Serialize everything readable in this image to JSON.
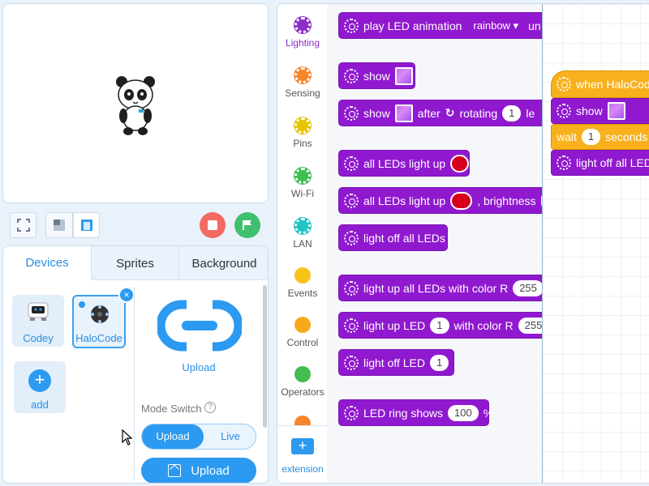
{
  "stage": {},
  "devices_panel": {
    "tabs": [
      {
        "label": "Devices",
        "active": true
      },
      {
        "label": "Sprites",
        "active": false
      },
      {
        "label": "Background",
        "active": false
      }
    ],
    "devices": [
      {
        "label": "Codey",
        "selected": false
      },
      {
        "label": "HaloCode",
        "selected": true
      }
    ],
    "close_glyph": "×",
    "add_label": "add",
    "add_glyph": "+",
    "upload_caption": "Upload",
    "mode_switch_label": "Mode Switch",
    "help_glyph": "?",
    "mode_options": [
      "Upload",
      "Live"
    ],
    "mode_selected": "Upload",
    "upload_button_label": "Upload"
  },
  "categories": {
    "items": [
      {
        "label": "Lighting",
        "color": "#8a2fc7",
        "active": true
      },
      {
        "label": "Sensing",
        "color": "#f5862a",
        "active": false
      },
      {
        "label": "Pins",
        "color": "#e6c400",
        "active": false
      },
      {
        "label": "Wi-Fi",
        "color": "#3fbf50",
        "active": false
      },
      {
        "label": "LAN",
        "color": "#1fc4c4",
        "active": false
      },
      {
        "label": "Events",
        "color": "#f8c31a",
        "active": false
      },
      {
        "label": "Control",
        "color": "#f8a91a",
        "active": false
      },
      {
        "label": "Operators",
        "color": "#43bd4f",
        "active": false
      }
    ],
    "extension_glyph": "+",
    "extension_label": "extension"
  },
  "palette": {
    "b1": {
      "text": "play LED animation",
      "option": "rainbow",
      "tail": "un"
    },
    "b2": {
      "text": "show"
    },
    "b3": {
      "text": "show",
      "after": "after",
      "rotating": "rotating",
      "value": "1",
      "tail": "le"
    },
    "b4": {
      "text": "all LEDs light up"
    },
    "b5": {
      "text": "all LEDs light up",
      "tail": ", brightness"
    },
    "b6": {
      "text": "light off all LEDs"
    },
    "b7": {
      "text": "light up all LEDs with color R",
      "value": "255"
    },
    "b8": {
      "text": "light up LED",
      "value": "1",
      "tail": "with color R",
      "value2": "255"
    },
    "b9": {
      "text": "light off LED",
      "value": "1"
    },
    "b10": {
      "text": "LED ring shows",
      "value": "100",
      "tail": "%"
    }
  },
  "workspace": {
    "hat": "when HaloCode",
    "show": "show",
    "wait_label": "wait",
    "wait_value": "1",
    "wait_unit": "seconds",
    "off": "light off all LED"
  }
}
